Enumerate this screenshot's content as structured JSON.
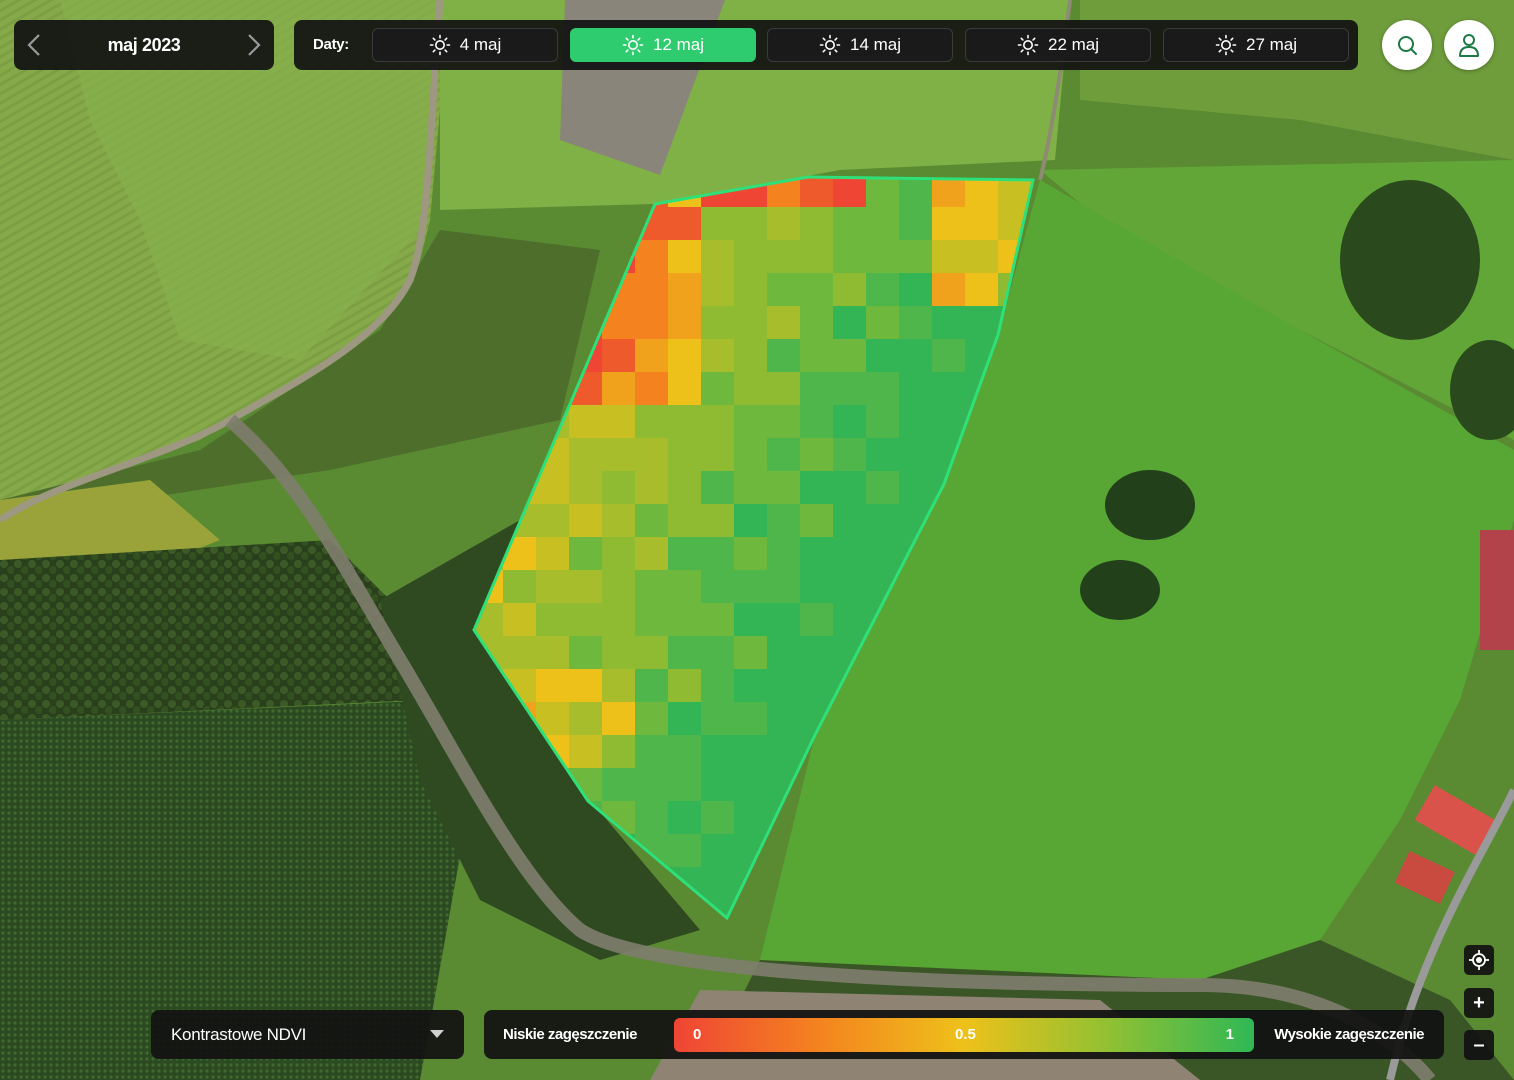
{
  "month": {
    "label": "maj 2023"
  },
  "dates": {
    "label": "Daty:",
    "items": [
      {
        "label": "4 maj",
        "active": false
      },
      {
        "label": "12 maj",
        "active": true
      },
      {
        "label": "14 maj",
        "active": false
      },
      {
        "label": "22 maj",
        "active": false
      },
      {
        "label": "27 maj",
        "active": false
      }
    ]
  },
  "layer": {
    "selected": "Kontrastowe NDVI"
  },
  "legend": {
    "low_label": "Niskie zagęszczenie",
    "high_label": "Wysokie zagęszczenie",
    "min": "0",
    "mid": "0.5",
    "max": "1"
  },
  "colors": {
    "accent": "#2ecc6e",
    "ndvi_low": "#ef4535",
    "ndvi_mid": "#eec11a",
    "ndvi_high": "#2fb855",
    "field_outline": "#2ee07a"
  },
  "icons": {
    "prev": "chevron-left-icon",
    "next": "chevron-right-icon",
    "date": "sun-icon",
    "search": "search-icon",
    "user": "user-icon",
    "locate": "locate-icon",
    "zoom_in": "plus-icon",
    "zoom_out": "minus-icon",
    "dropdown": "caret-down-icon"
  },
  "controls": {
    "zoom_in": "+",
    "zoom_out": "–"
  }
}
